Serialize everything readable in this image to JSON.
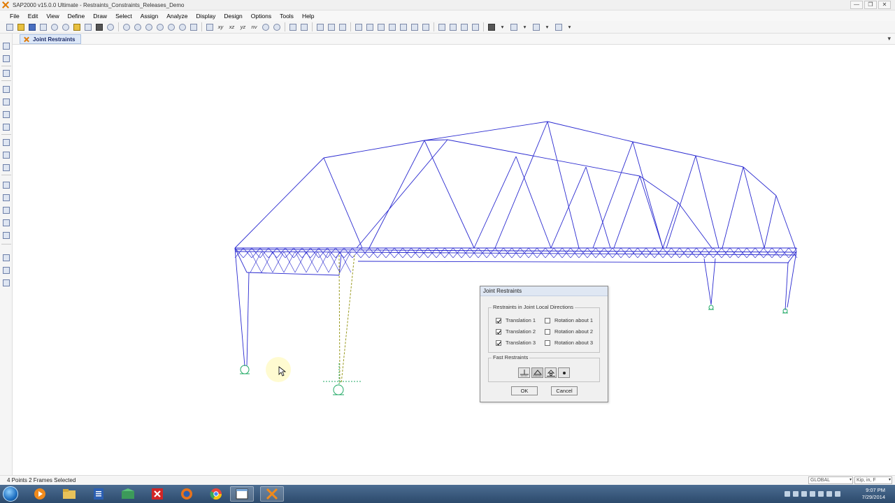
{
  "window": {
    "title": "SAP2000 v15.0.0 Ultimate - Restraints_Constraints_Releases_Demo",
    "controls": [
      "—",
      "❐",
      "✕"
    ]
  },
  "menu": [
    "File",
    "Edit",
    "View",
    "Define",
    "Draw",
    "Select",
    "Assign",
    "Analyze",
    "Display",
    "Design",
    "Options",
    "Tools",
    "Help"
  ],
  "toolbar": {
    "view_labels": [
      "xy",
      "xz",
      "yz",
      "nv"
    ]
  },
  "tab": {
    "label": "Joint Restraints"
  },
  "dialog": {
    "title": "Joint Restraints",
    "group_directions": "Restraints in Joint Local Directions",
    "translation_1": "Translation  1",
    "translation_2": "Translation  2",
    "translation_3": "Translation  3",
    "rotation_1": "Rotation about  1",
    "rotation_2": "Rotation about  2",
    "rotation_3": "Rotation about  3",
    "translation_checked": [
      true,
      true,
      true
    ],
    "rotation_checked": [
      false,
      false,
      false
    ],
    "group_fast": "Fast Restraints",
    "ok_label": "OK",
    "cancel_label": "Cancel"
  },
  "status": {
    "selection": "4 Points  2 Frames Selected",
    "coord_system": "GLOBAL",
    "units": "Kip, in, F"
  },
  "taskbar": {
    "time": "9:07 PM",
    "date": "7/29/2014"
  },
  "colors": {
    "frame": "#2a2ad0",
    "selected": "#9a9a20",
    "support": "#22aa66",
    "tab_bg": "#dde8f8",
    "dialog_bg": "#f0f0f0"
  }
}
